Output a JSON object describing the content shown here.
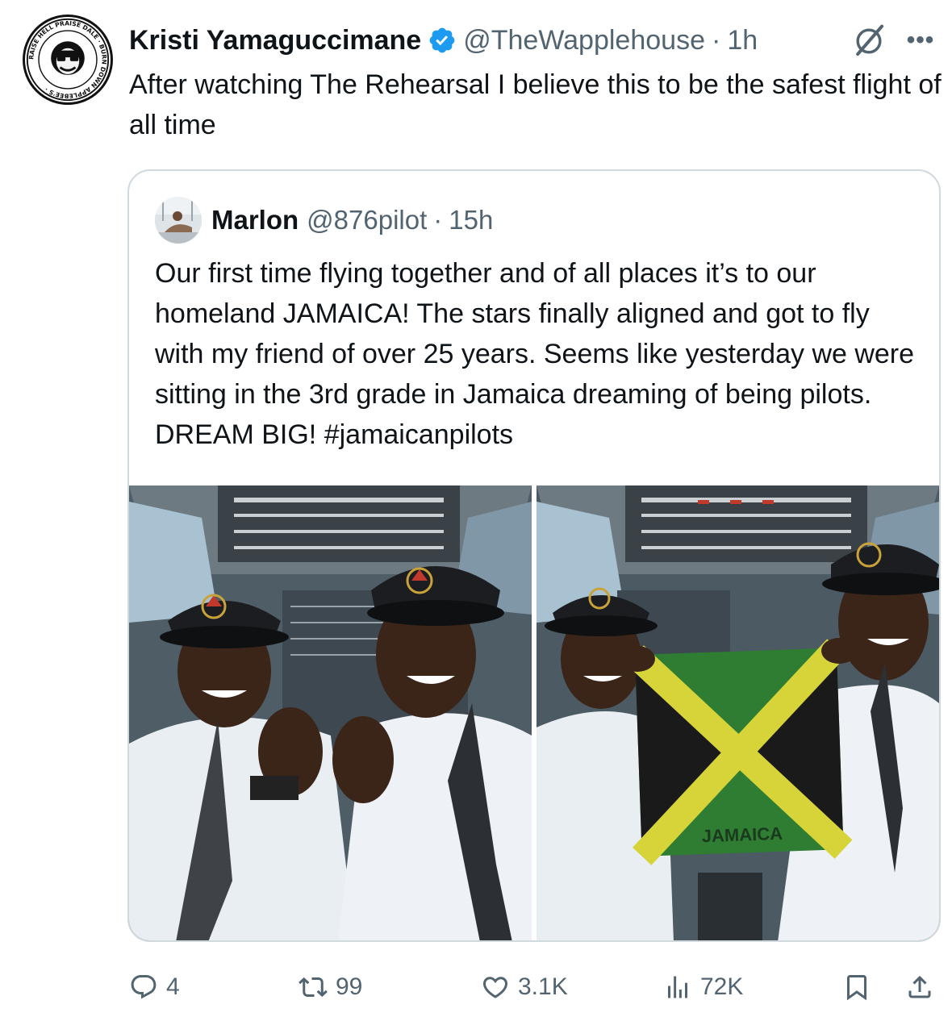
{
  "tweet": {
    "author_name": "Kristi Yamaguccimane",
    "author_handle": "@TheWapplehouse",
    "separator": "·",
    "time": "1h",
    "text": "After watching The Rehearsal I believe this to be the safest flight of all time",
    "avatar_ring_text": "RAISE HELL PRAISE DALE · BURN DOWN APPLEBEE'S"
  },
  "quote": {
    "author_name": "Marlon",
    "author_handle": "@876pilot",
    "separator": "·",
    "time": "15h",
    "text": "Our first time flying together and of all places it’s to our homeland JAMAICA! The stars finally aligned and got to fly with my friend of over 25 years. Seems like yesterday we were sitting in the 3rd grade in Jamaica dreaming of being pilots. DREAM BIG! #jamaicanpilots",
    "photo_flag_text": "JAMAICA"
  },
  "actions": {
    "replies": "4",
    "reposts": "99",
    "likes": "3.1K",
    "views": "72K"
  },
  "colors": {
    "text": "#0f1419",
    "secondary": "#536471",
    "border": "#cfd9de",
    "verified": "#1d9bf0",
    "flag_green": "#2e7d32",
    "flag_yellow": "#d7d43a"
  },
  "icons": [
    "verified-badge-icon",
    "grok-icon",
    "more-icon",
    "reply-icon",
    "repost-icon",
    "like-icon",
    "views-icon",
    "bookmark-icon",
    "share-icon"
  ]
}
